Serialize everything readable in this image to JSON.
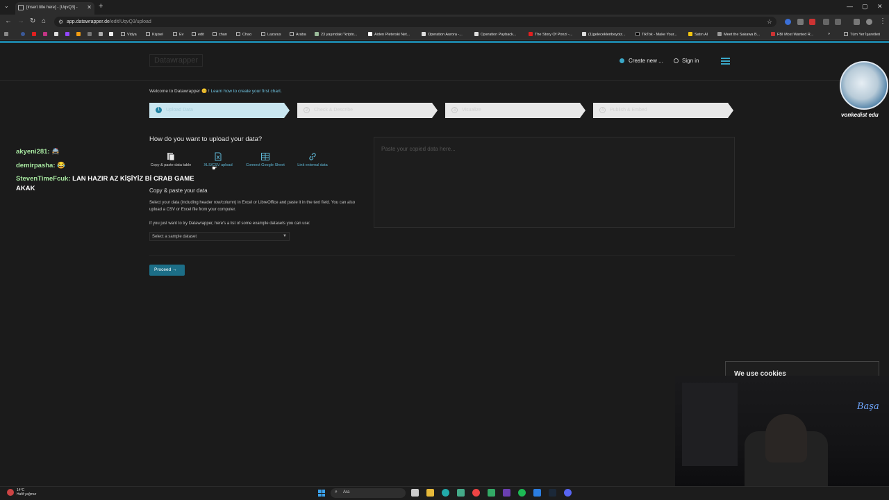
{
  "browser": {
    "tab_title": "[insert title here] - [UqvQ3] - ",
    "url_host": "app.datawrapper.de",
    "url_path": "/edit/UqvQ3/upload",
    "bookmarks": [
      "Vidya",
      "Kişisel",
      "Ev",
      "edit",
      "chan",
      "Chao",
      "Lazarus",
      "Araba",
      "23 yaşındaki \"kripto...",
      "Aiden Pleterski Net...",
      "Operation Aurora -...",
      "Operation Payback...",
      "The Story Of Ponzi -...",
      "(1)geleceklenbeyoiz...",
      "TikTok - Make Your...",
      "Satın Al",
      "Meet the Sakawa B...",
      "FBI Most Wanted R..."
    ],
    "bookmarks_overflow": "»",
    "all_bookmarks": "Tüm Yer İşaretleri"
  },
  "app": {
    "logo": "Datawrapper",
    "create_new": "Create new ...",
    "sign_in": "Sign in",
    "welcome_text": "Welcome to Datawrapper 😊 ! ",
    "welcome_link": "Learn how to create your first chart.",
    "steps": [
      {
        "num": "1",
        "label": "Upload Data"
      },
      {
        "num": "2",
        "label": "Check & Describe"
      },
      {
        "num": "3",
        "label": "Visualize"
      },
      {
        "num": "4",
        "label": "Publish & Embed"
      }
    ],
    "upload_question": "How do you want to upload your data?",
    "upload_options": [
      {
        "label": "Copy & paste data table",
        "icon": "clipboard-icon"
      },
      {
        "label": "XLS/CSV upload",
        "icon": "file-excel-icon"
      },
      {
        "label": "Connect Google Sheet",
        "icon": "table-icon"
      },
      {
        "label": "Link external data",
        "icon": "link-icon"
      }
    ],
    "section_title": "Copy & paste your data",
    "description": "Select your data (including header row/column) in Excel or LibreOffice and paste it in the text field. You can also upload a CSV or Excel file from your computer.",
    "sample_hint": "If you just want to try Datawrapper, here's a list of some example datasets you can use:",
    "sample_select": "Select a sample dataset",
    "proceed": "Proceed →",
    "paste_placeholder": "Paste your copied data here...",
    "cookie_title": "We use cookies"
  },
  "overlay": {
    "chat": [
      {
        "user": "akyeni281:",
        "msg": "🚔"
      },
      {
        "user": "demirpasha:",
        "msg": "😂"
      },
      {
        "user": "StevenTimeFcuk:",
        "msg": "LAN HAZIR AZ KİŞİYİZ Bİ CRAB GAME"
      },
      {
        "user": "",
        "msg": "AKAK"
      }
    ],
    "avatar_name": "vonkedist edu",
    "neon_sign": "Başa"
  },
  "taskbar": {
    "temp": "14°C",
    "weather": "Hafif yağmur",
    "search": "Ara"
  },
  "colors": {
    "accent": "#1d81a2",
    "link": "#6fc3e0",
    "active_option": "#5fb9d8",
    "chat_user": "#a7e7a0"
  }
}
